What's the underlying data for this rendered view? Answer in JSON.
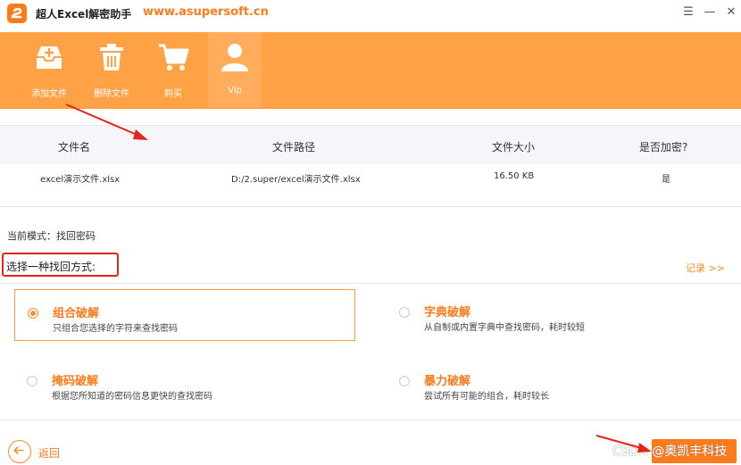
{
  "app": {
    "title": "超人Excel解密助手",
    "website": "www.asupersoft.cn",
    "window_controls": {
      "menu": "☰",
      "minimize": "—",
      "close": "✕"
    }
  },
  "toolbar": {
    "items": [
      {
        "label": "添加文件",
        "icon": "add-file-icon"
      },
      {
        "label": "删除文件",
        "icon": "trash-icon"
      },
      {
        "label": "购买",
        "icon": "cart-icon"
      },
      {
        "label": "Vip",
        "icon": "user-icon"
      }
    ]
  },
  "table": {
    "headers": [
      "文件名",
      "文件路径",
      "文件大小",
      "是否加密?"
    ],
    "rows": [
      [
        "excel演示文件.xlsx",
        "D:/2.super/excel演示文件.xlsx",
        "16.50 KB",
        "是"
      ]
    ]
  },
  "mode": {
    "current": "当前模式：找回密码"
  },
  "recovery": {
    "choose_label": "选择一种找回方式:",
    "records_link": "记录 >>",
    "options": [
      {
        "title": "组合破解",
        "desc": "只组合您选择的字符来查找密码",
        "selected": true
      },
      {
        "title": "字典破解",
        "desc": "从自制或内置字典中查找密码，耗时较短",
        "selected": false
      },
      {
        "title": "掩码破解",
        "desc": "根据您所知道的密码信息更快的查找密码",
        "selected": false
      },
      {
        "title": "暴力破解",
        "desc": "尝试所有可能的组合，耗时较长",
        "selected": false
      }
    ]
  },
  "footer": {
    "back_label": "返回",
    "watermark": "CSDN @奥凯丰科技"
  },
  "colors": {
    "brand": "#ff7a1a",
    "toolbar": "#ffa245",
    "annotation": "#e5251a"
  }
}
